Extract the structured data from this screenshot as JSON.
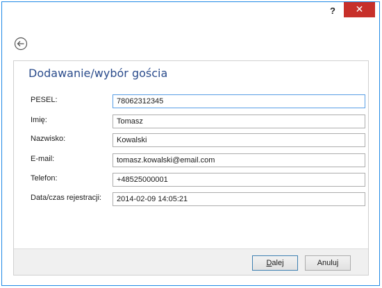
{
  "titlebar": {
    "help_label": "?",
    "close_label": "✕"
  },
  "back_button": {
    "icon": "back-arrow-icon"
  },
  "panel": {
    "title": "Dodawanie/wybór gościa",
    "fields": [
      {
        "label": "PESEL:",
        "value": "78062312345"
      },
      {
        "label": "Imię:",
        "value": "Tomasz"
      },
      {
        "label": "Nazwisko:",
        "value": "Kowalski"
      },
      {
        "label": "E-mail:",
        "value": "tomasz.kowalski@email.com"
      },
      {
        "label": "Telefon:",
        "value": "+48525000001"
      },
      {
        "label": "Data/czas rejestracji:",
        "value": "2014-02-09 14:05:21"
      }
    ]
  },
  "footer": {
    "next_accel": "D",
    "next_rest": "alej",
    "cancel_label": "Anuluj"
  },
  "colors": {
    "accent": "#2b4c8c",
    "close": "#c7302a",
    "window_border": "#1e88e5"
  }
}
